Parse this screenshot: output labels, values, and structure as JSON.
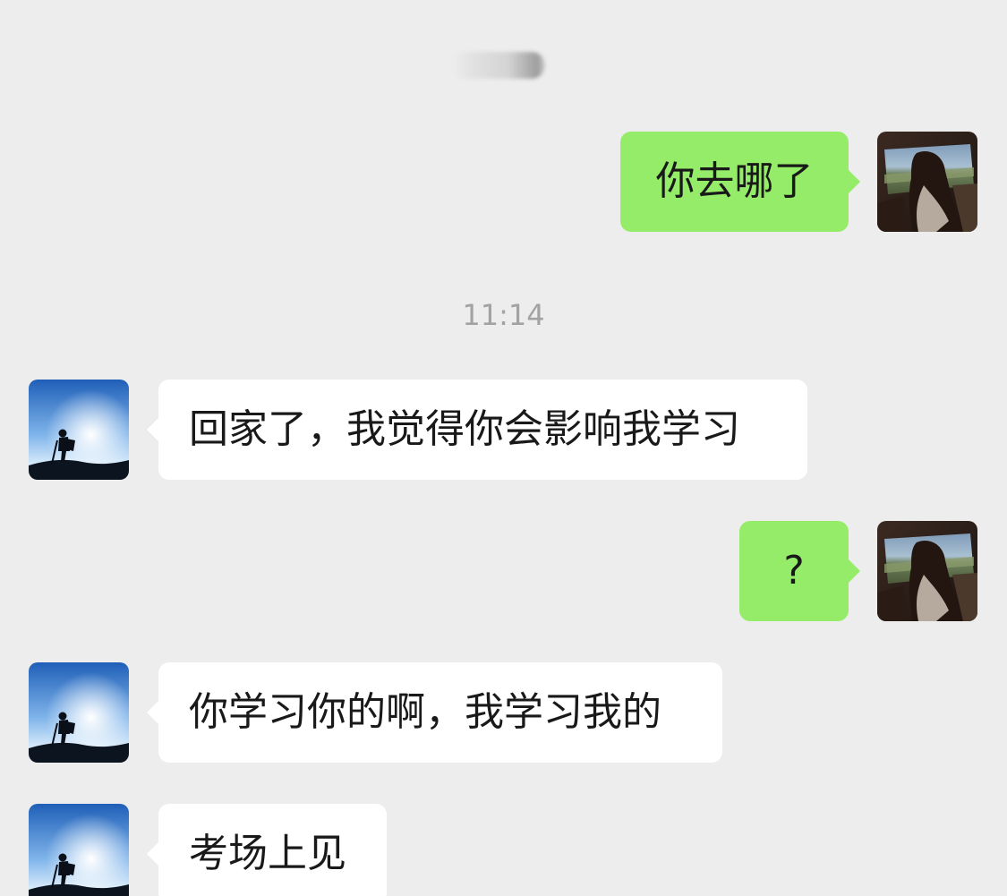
{
  "timestamp": "11:14",
  "messages": [
    {
      "from": "me",
      "text": "你去哪了",
      "avatar": "car-window-avatar-icon"
    },
    {
      "from": "contact",
      "text": "回家了，我觉得你会影响我学习",
      "avatar": "hiker-silhouette-avatar-icon"
    },
    {
      "from": "me",
      "text": "?",
      "avatar": "car-window-avatar-icon"
    },
    {
      "from": "contact",
      "text": "你学习你的啊，我学习我的",
      "avatar": "hiker-silhouette-avatar-icon"
    },
    {
      "from": "contact",
      "text": "考场上见",
      "avatar": "hiker-silhouette-avatar-icon"
    }
  ],
  "colors": {
    "background": "#ededed",
    "sent_bubble": "#95ec69",
    "received_bubble": "#ffffff",
    "text": "#191919",
    "timestamp": "#a2a2a2"
  }
}
